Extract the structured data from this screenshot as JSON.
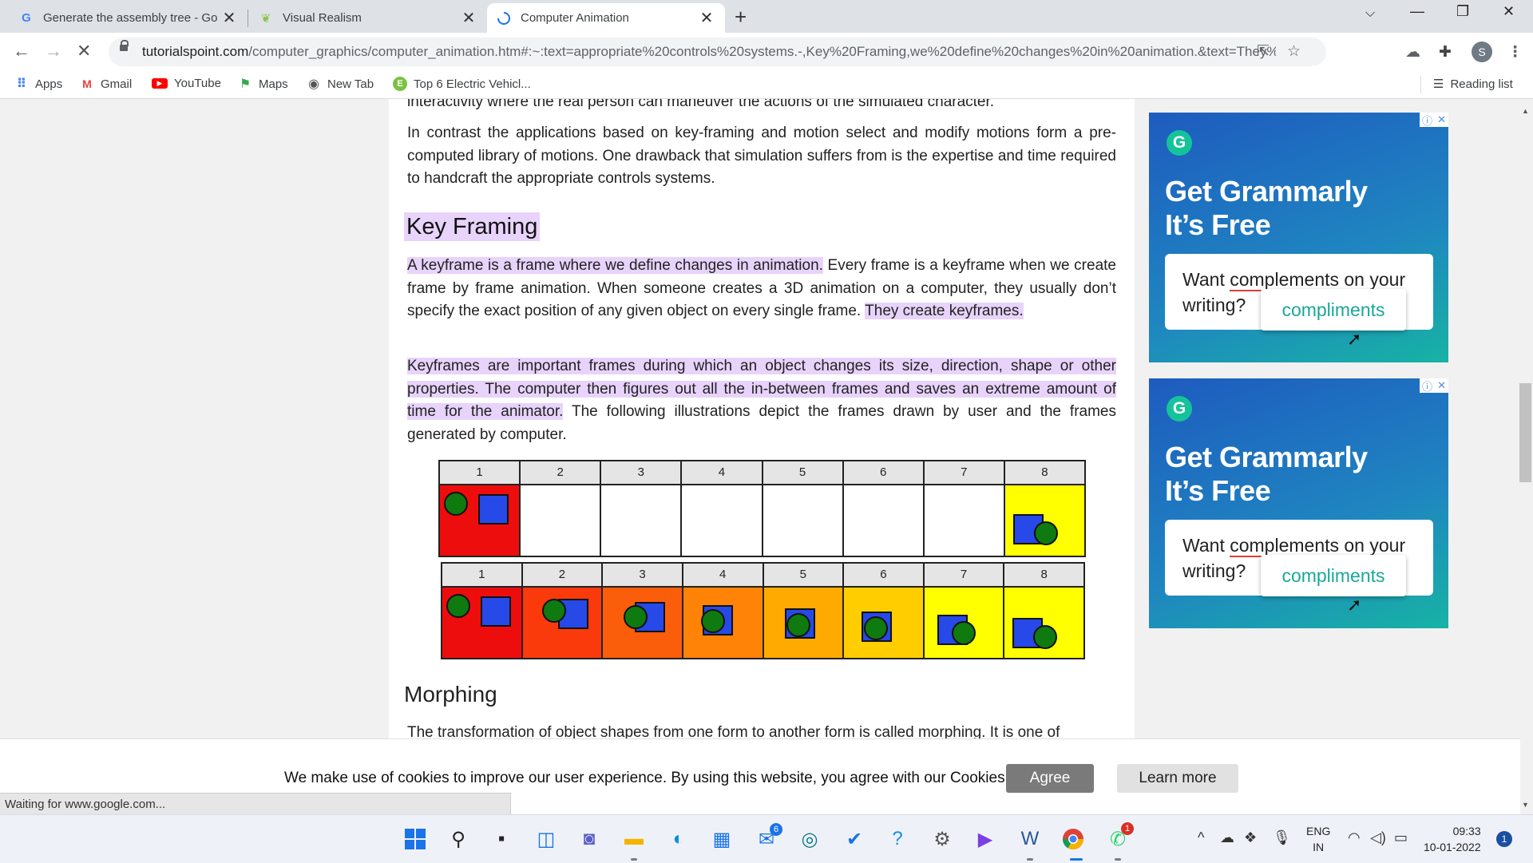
{
  "browser": {
    "tabs": [
      {
        "title": "Generate the assembly tree - Go",
        "favicon": "G"
      },
      {
        "title": "Visual Realism",
        "favicon": "leaf"
      },
      {
        "title": "Computer Animation",
        "favicon": "loading"
      }
    ],
    "url_host": "tutorialspoint.com",
    "url_rest": "/computer_graphics/computer_animation.htm#:~:text=appropriate%20controls%20systems.-,Key%20Framing,we%20define%20changes%20in%20animation.&text=They%2...",
    "profile_initial": "S",
    "bookmarks": [
      {
        "label": "Apps",
        "icon": "apps-grid-icon"
      },
      {
        "label": "Gmail",
        "icon": "gmail-icon"
      },
      {
        "label": "YouTube",
        "icon": "youtube-icon"
      },
      {
        "label": "Maps",
        "icon": "maps-icon"
      },
      {
        "label": "New Tab",
        "icon": "globe-icon"
      },
      {
        "label": "Top 6 Electric Vehicl...",
        "icon": "site-icon"
      }
    ],
    "reading_list": "Reading list",
    "status": "Waiting for www.google.com..."
  },
  "article": {
    "partial_top": "interactivity where the real person can maneuver the actions of the simulated character.",
    "p1": "In contrast the applications based on key-framing and motion select and modify motions form a pre-computed library of motions. One drawback that simulation suffers from is the expertise and time required to handcraft the appropriate controls systems.",
    "heading_keyframing": "Key Framing",
    "p2_hl1": "A keyframe is a frame where we define changes in animation.",
    "p2_mid": " Every frame is a keyframe when we create frame by frame animation. When someone creates a 3D animation on a computer, they usually don’t specify the exact position of any given object on every single frame. ",
    "p2_hl2": "They create keyframes.",
    "p3_hl": "Keyframes are important frames during which an object changes its size, direction, shape or other properties. The computer then figures out all the in-between frames and saves an extreme amount of time for the animator.",
    "p3_rest": " The following illustrations depict the frames drawn by user and the frames generated by computer.",
    "frame_numbers": [
      "1",
      "2",
      "3",
      "4",
      "5",
      "6",
      "7",
      "8"
    ],
    "user_frames_colors": [
      "#ee0d0d",
      "#ffffff",
      "#ffffff",
      "#ffffff",
      "#ffffff",
      "#ffffff",
      "#ffffff",
      "#ffff00"
    ],
    "computer_frames_colors": [
      "#ee0d0d",
      "#fb3a0c",
      "#fb5e0a",
      "#ff8306",
      "#ffaa00",
      "#ffcd00",
      "#ffff00",
      "#ffff00"
    ],
    "heading_morphing": "Morphing",
    "partial_bottom": "The transformation of object shapes from one form to another form is called morphing. It is one of"
  },
  "ads": [
    {
      "title_line1": "Get Grammarly",
      "title_line2": "It’s Free",
      "q_pre": "Want ",
      "q_word": "complements",
      "q_post": " on your writing?",
      "suggestion": "compliments"
    },
    {
      "title_line1": "Get Grammarly",
      "title_line2": "It’s Free",
      "q_pre": "Want ",
      "q_word": "complements",
      "q_post": " on your writing?",
      "suggestion": "compliments"
    }
  ],
  "cookie": {
    "text": "We make use of cookies to improve our user experience. By using this website, you agree with our Cookies Policy.",
    "agree": "Agree",
    "learn_more": "Learn more"
  },
  "taskbar": {
    "lang_line1": "ENG",
    "lang_line2": "IN",
    "time": "09:33",
    "date": "10-01-2022",
    "notifications": "1",
    "mail_badge": "6",
    "whatsapp_badge": "1"
  }
}
